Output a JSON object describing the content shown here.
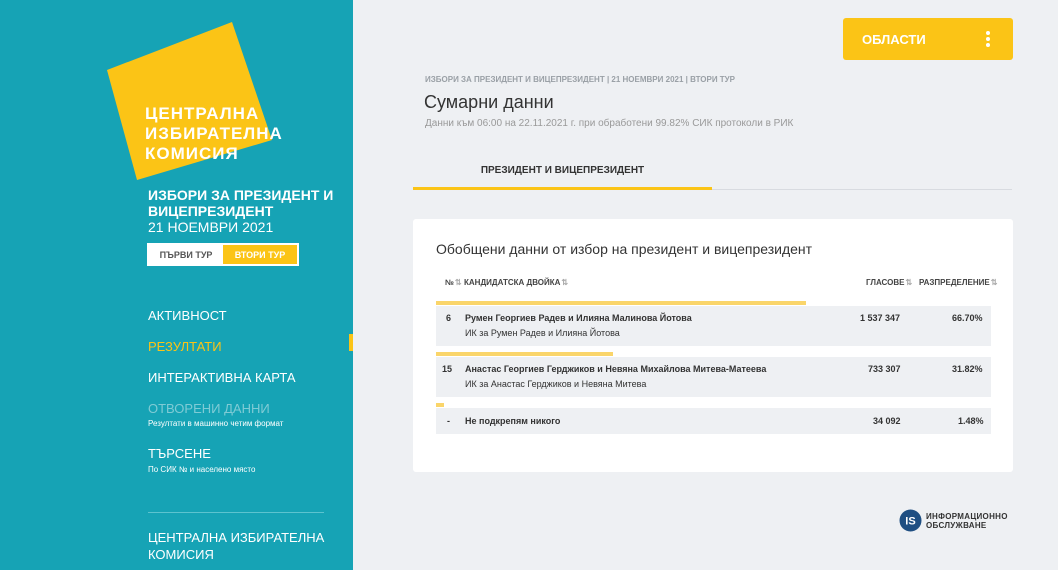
{
  "sidebar": {
    "logo_lines": [
      "ЦЕНТРАЛНА",
      "ИЗБИРАТЕЛНА",
      "КОМИСИЯ"
    ],
    "election_title": "ИЗБОРИ ЗА ПРЕЗИДЕНТ И ВИЦЕПРЕЗИДЕНТ",
    "election_date": "21 НОЕМВРИ 2021",
    "rounds": [
      "ПЪРВИ ТУР",
      "ВТОРИ ТУР"
    ],
    "nav": {
      "activity": "АКТИВНОСТ",
      "results": "РЕЗУЛТАТИ",
      "map": "ИНТЕРАКТИВНА КАРТА",
      "open_data": "ОТВОРЕНИ ДАННИ",
      "open_data_sub": "Резултати в машинно четим формат",
      "search": "ТЪРСЕНЕ",
      "search_sub": "По СИК № и населено място"
    },
    "footer": "ЦЕНТРАЛНА ИЗБИРАТЕЛНА КОМИСИЯ"
  },
  "header": {
    "areas_button": "ОБЛАСТИ",
    "breadcrumb": "ИЗБОРИ ЗА ПРЕЗИДЕНТ И ВИЦЕПРЕЗИДЕНТ | 21 НОЕМВРИ 2021 | ВТОРИ ТУР",
    "title": "Сумарни данни",
    "subtitle": "Данни към 06:00 на 22.11.2021 г. при обработени 99.82% СИК протоколи в РИК",
    "tab": "ПРЕЗИДЕНТ И ВИЦЕПРЕЗИДЕНТ"
  },
  "results": {
    "title": "Обобщени данни от избор на президент и вицепрезидент",
    "headers": {
      "number": "№",
      "candidates": "КАНДИДАТСКА ДВОЙКА",
      "votes": "ГЛАСОВЕ",
      "distribution": "РАЗПРЕДЕЛЕНИЕ"
    },
    "rows": [
      {
        "number": "6",
        "name": "Румен Георгиев Радев и Илияна Малинова Йотова",
        "committee": "ИК за Румен Радев и Илияна Йотова",
        "votes": "1 537 347",
        "percent": "66.70%",
        "share": 0.667
      },
      {
        "number": "15",
        "name": "Анастас Георгиев Герджиков и Невяна Михайлова Митева-Матеева",
        "committee": "ИК за Анастас Герджиков и Невяна Митева",
        "votes": "733 307",
        "percent": "31.82%",
        "share": 0.3182
      },
      {
        "number": "-",
        "name": "Не подкрепям никого",
        "committee": "",
        "votes": "34 092",
        "percent": "1.48%",
        "share": 0.0148
      }
    ]
  },
  "footer_logo": {
    "mark": "IS",
    "line1": "ИНФОРМАЦИОННО",
    "line2": "ОБСЛУЖВАНЕ"
  },
  "colors": {
    "sidebar": "#16a3b5",
    "accent": "#fbc416",
    "bar": "#fad56a"
  }
}
